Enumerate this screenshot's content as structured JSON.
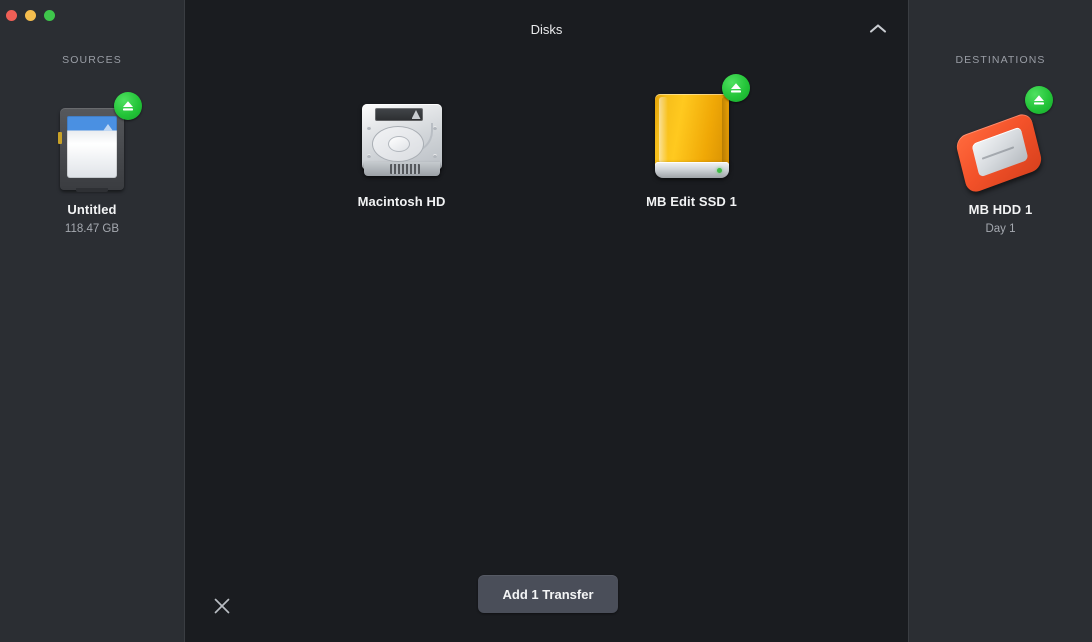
{
  "window": {
    "traffic_lights": [
      {
        "name": "close",
        "color": "#ef5f56"
      },
      {
        "name": "minimize",
        "color": "#f4bd4e"
      },
      {
        "name": "zoom",
        "color": "#3ec64b"
      }
    ]
  },
  "sources": {
    "heading": "SOURCES",
    "disks": [
      {
        "name": "Untitled",
        "sub": "118.47 GB",
        "icon": "sd-card-icon",
        "eject_badge": true
      }
    ]
  },
  "main": {
    "title": "Disks",
    "collapse_icon": "chevron-up-icon",
    "disks": [
      {
        "name": "Macintosh HD",
        "sub": "",
        "icon": "internal-hard-drive-icon",
        "eject_badge": false
      },
      {
        "name": "MB Edit SSD 1",
        "sub": "",
        "icon": "external-ssd-icon",
        "eject_badge": true
      }
    ],
    "footer": {
      "close_icon": "close-x-icon",
      "add_transfer_label": "Add 1 Transfer"
    }
  },
  "destinations": {
    "heading": "DESTINATIONS",
    "disks": [
      {
        "name": "MB HDD 1",
        "sub": "Day 1",
        "icon": "rugged-external-drive-icon",
        "eject_badge": true
      }
    ]
  },
  "colors": {
    "window_bg": "#1a1c20",
    "sidebar_bg": "#2b2e33",
    "divider": "#3a3d42",
    "text_primary": "#f2f3f4",
    "text_secondary": "#a5a9b0",
    "eject_green": "#23c438",
    "button_bg": "#4a4e59"
  }
}
